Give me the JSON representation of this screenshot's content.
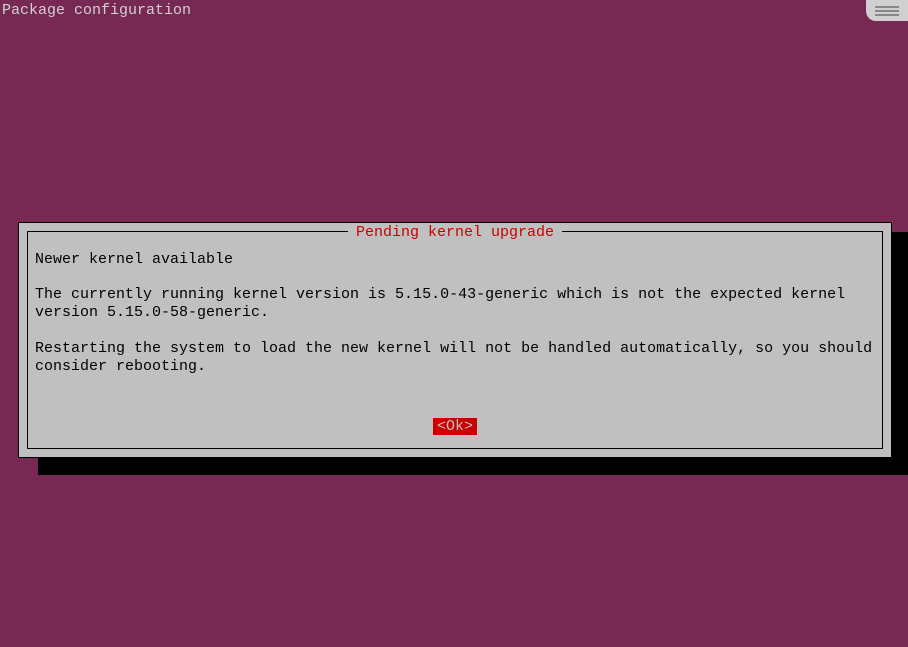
{
  "header": {
    "title": "Package configuration"
  },
  "dialog": {
    "title": "Pending kernel upgrade",
    "heading": "Newer kernel available",
    "paragraph1": "The currently running kernel version is 5.15.0-43-generic which is not the expected kernel version 5.15.0-58-generic.",
    "paragraph2": "Restarting the system to load the new kernel will not be handled automatically, so you should consider rebooting.",
    "ok_button": "<Ok>"
  },
  "kernel": {
    "running_version": "5.15.0-43-generic",
    "expected_version": "5.15.0-58-generic"
  }
}
